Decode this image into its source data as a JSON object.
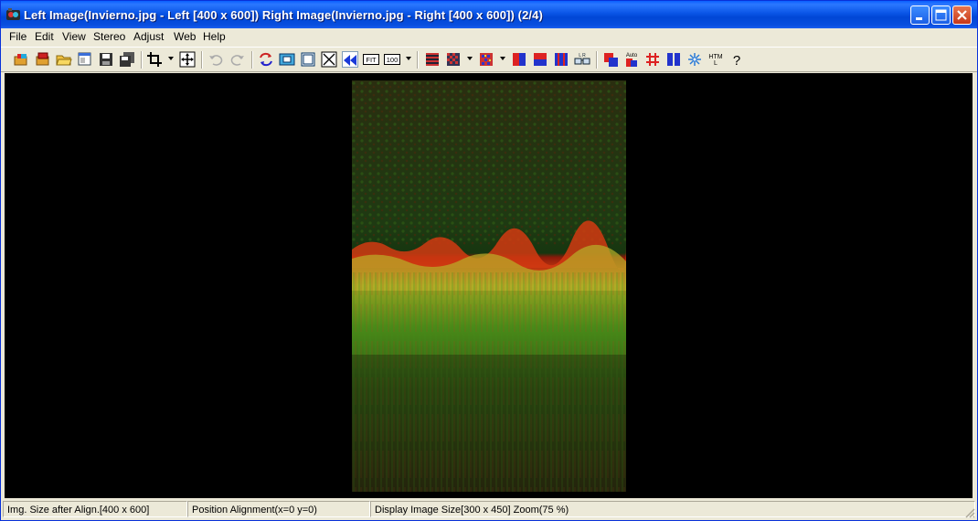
{
  "window": {
    "title": "Left Image(Invierno.jpg - Left [400 x 600]) Right Image(Invierno.jpg - Right [400 x 600])  (2/4)"
  },
  "menu": {
    "file": "File",
    "edit": "Edit",
    "view": "View",
    "stereo": "Stereo",
    "adjust": "Adjust",
    "web": "Web",
    "help": "Help"
  },
  "toolbar": {
    "fit_label": "FIT",
    "zoom100_label": "100",
    "auto_label": "Auto",
    "html_label_top": "HTM",
    "html_label_bottom": "L",
    "help_label": "?"
  },
  "status": {
    "img_size": "Img. Size after Align.[400 x 600]",
    "position": "Position Alignment(x=0 y=0)",
    "display": "Display Image Size[300 x 450]  Zoom(75 %)"
  },
  "colors": {
    "titlebar": "#0a4fe0",
    "chrome": "#ece9d8",
    "canvas": "#000000"
  }
}
